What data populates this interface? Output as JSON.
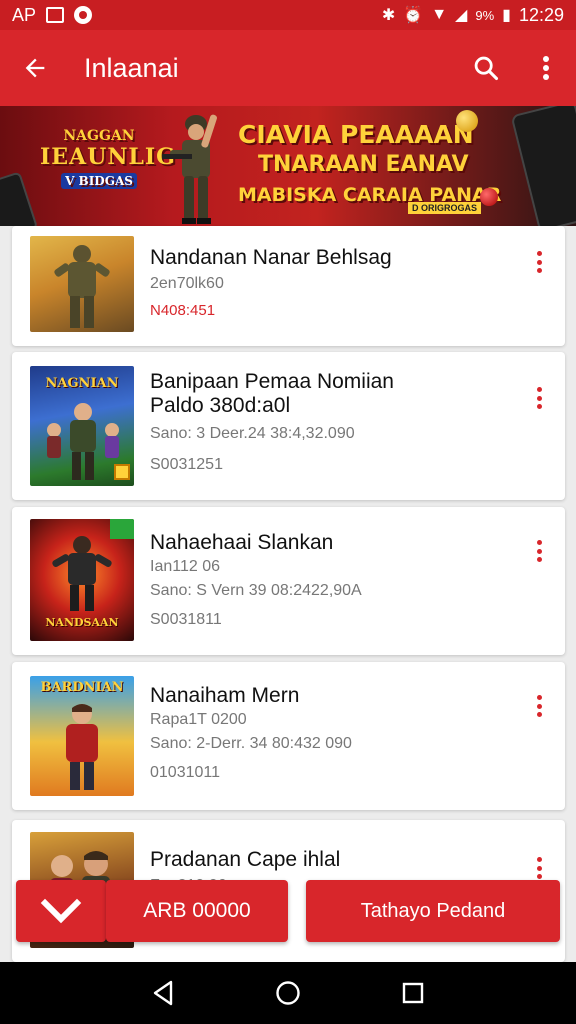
{
  "status_bar": {
    "carrier": "AP",
    "battery": "9%",
    "time": "12:29"
  },
  "app_bar": {
    "title": "Inlaanai",
    "icons": [
      "back-arrow-icon",
      "search-icon",
      "more-vert-icon"
    ]
  },
  "banner": {
    "logo_line1": "NAGGAN",
    "logo_line2": "IEAUNLIG",
    "logo_line3": "V BIDGAS",
    "headline_line1": "CIAVIA PEAAAAN",
    "headline_line2": "TNARAAN EANAV",
    "headline_line3": "MABISKA CARAIA PANAR",
    "fineprint": "D ORIGROGAS"
  },
  "items": [
    {
      "name": "Nandanan Nanar Behlsag",
      "meta": "2en70lk60",
      "price": "N408:451",
      "thumb_caption": ""
    },
    {
      "name": "Banipaan Pemaa Nomiian",
      "name2": "Paldo 380d:a0l",
      "meta": "Sano: 3 Deer.24 38:4,32.090",
      "code": "S0031251",
      "thumb_caption": "NAGNIAN"
    },
    {
      "name": "Nahaehaai Slankan",
      "meta": "Ian112 06",
      "meta2": "Sano: S Vern 39 08:2422,90A",
      "code": "S0031811",
      "thumb_caption": "NANDSAAN"
    },
    {
      "name": "Nanaiham Mern",
      "meta": "Rapa1T 0200",
      "meta2": "Sano: 2-Derr. 34 80:432 090",
      "code": "01031011",
      "thumb_caption": "BARDNIAN"
    },
    {
      "name": "Pradanan Cape ihlal",
      "meta": "Fan210 06",
      "thumb_caption": ""
    }
  ],
  "actions": {
    "amount_label": "ARB 00000",
    "order_label": "Tathayo Pedand"
  },
  "colors": {
    "primary": "#d8262b",
    "status_bar": "#c81e22",
    "accent_gold": "#ffd23a"
  }
}
